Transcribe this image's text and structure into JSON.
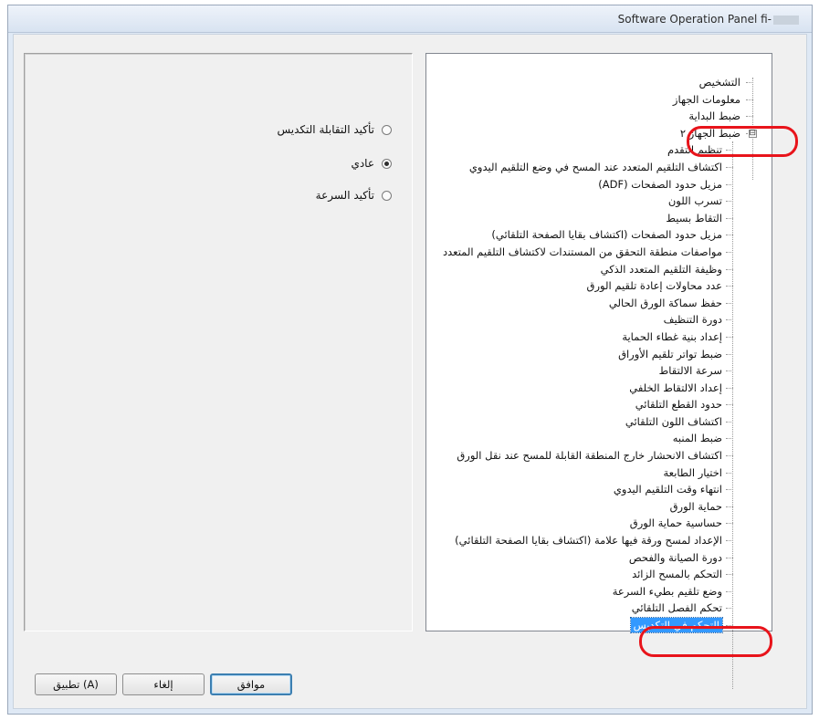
{
  "window": {
    "title": "Software Operation Panel fi-"
  },
  "options": {
    "items": [
      {
        "label": "تأكيد التقابلة التكديس",
        "checked": false
      },
      {
        "label": "عادي",
        "checked": true
      },
      {
        "label": "تأكيد السرعة",
        "checked": false
      }
    ]
  },
  "tree": {
    "top_items": [
      {
        "label": "التشخيص"
      },
      {
        "label": "معلومات الجهاز"
      },
      {
        "label": "ضبط البداية"
      }
    ],
    "expanded_item": {
      "label": "ضبط الجهاز ٢",
      "expander": "⊟"
    },
    "children": [
      {
        "label": "تنظيم التقدم"
      },
      {
        "label": "اكتشاف التلقيم المتعدد عند المسح في وضع التلقيم اليدوي"
      },
      {
        "label": "مزيل حدود الصفحات (ADF)"
      },
      {
        "label": "تسرب اللون"
      },
      {
        "label": "التقاط بسيط"
      },
      {
        "label": "مزيل حدود الصفحات (اكتشاف بقايا الصفحة التلقائي)"
      },
      {
        "label": "مواصفات منطقة التحقق من المستندات لاكتشاف التلقيم المتعدد"
      },
      {
        "label": "وظيفة التلقيم المتعدد الذكي"
      },
      {
        "label": "عدد محاولات إعادة تلقيم الورق"
      },
      {
        "label": "حفظ سماكة الورق الحالي"
      },
      {
        "label": "دورة التنظيف"
      },
      {
        "label": "إعداد بنية غطاء الحماية"
      },
      {
        "label": "ضبط تواتر تلقيم الأوراق"
      },
      {
        "label": "سرعة الالتقاط"
      },
      {
        "label": "إعداد الالتقاط الخلفي"
      },
      {
        "label": "حدود القطع التلقائي"
      },
      {
        "label": "اكتشاف اللون التلقائي"
      },
      {
        "label": "ضبط المنبه"
      },
      {
        "label": "اكتشاف الانحشار خارج المنطقة القابلة للمسح عند نقل الورق"
      },
      {
        "label": "اختيار الطابعة"
      },
      {
        "label": "انتهاء وقت التلقيم اليدوي"
      },
      {
        "label": "حماية الورق"
      },
      {
        "label": "حساسية حماية الورق"
      },
      {
        "label": "الإعداد لمسح ورقة فيها علامة (اكتشاف بقايا الصفحة التلقائي)"
      },
      {
        "label": "دورة الصيانة والفحص"
      },
      {
        "label": "التحكم بالمسح الزائد"
      },
      {
        "label": "وضع تلقيم بطيء السرعة"
      },
      {
        "label": "تحكم الفصل التلقائي"
      }
    ],
    "selected_item": {
      "label": "التحكم في التكديس"
    }
  },
  "buttons": {
    "ok": "موافق",
    "cancel": "إلغاء",
    "apply": "تطبيق (A)"
  },
  "colors": {
    "highlight": "#e8141b",
    "selection": "#3399ff"
  }
}
